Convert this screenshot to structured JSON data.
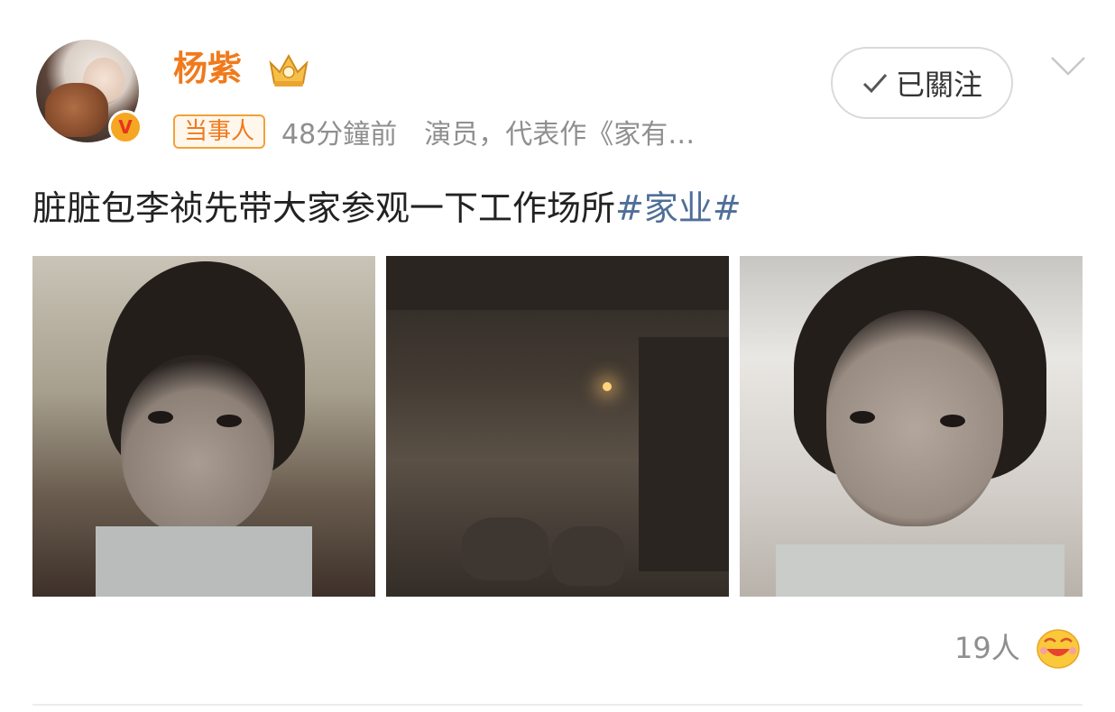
{
  "post": {
    "username": "杨紫",
    "badge": "当事人",
    "time": "48分鐘前",
    "description": "演员，代表作《家有…",
    "follow_label": "已關注",
    "text": "脏脏包李祯先带大家参观一下工作场所",
    "hashtag": "#家业#",
    "likes": "19人"
  },
  "icons": {
    "verified": "verified-v-badge",
    "crown": "vip-crown-icon",
    "check": "check-icon",
    "chevron": "chevron-down-icon",
    "reaction": "laughing-emoji-icon"
  },
  "colors": {
    "username": "#f07a1c",
    "hashtag": "#4f6f98",
    "meta": "#8f8f8f"
  }
}
